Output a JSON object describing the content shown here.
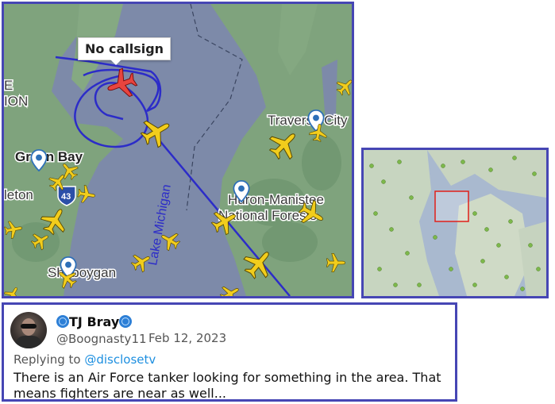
{
  "map_main": {
    "callout": "No callsign",
    "labels": {
      "green_bay": "Green Bay",
      "traverse_city": "Traverse City",
      "huron_manistee_1": "Huron-Manistee",
      "huron_manistee_2": "National Forests",
      "sheboygan": "Sheboygan",
      "lake_michigan": "Lake Michigan",
      "appleton_partial": "leton",
      "fragment_e": "E",
      "fragment_ion": "ION",
      "highway_43": "43"
    }
  },
  "map_mini": {},
  "tweet": {
    "display_name": "TJ Bray",
    "handle": "@Boognasty11",
    "date": "Feb 12, 2023",
    "replying_prefix": "Replying to ",
    "replying_to": "@disclosetv",
    "text": "There is an Air Force tanker looking for something in the area. That means fighters are near as well..."
  },
  "colors": {
    "border": "#4646b4",
    "water": "#7d8aa9",
    "land": "#7fa37d",
    "track": "#2c2cc8",
    "plane": "#f2cd1c",
    "target_plane": "#e8443e",
    "link": "#1d8fe0"
  }
}
